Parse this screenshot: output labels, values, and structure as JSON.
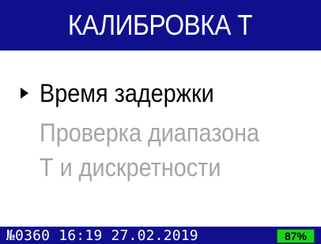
{
  "header": {
    "title": "КАЛИБРОВКА Т"
  },
  "menu": {
    "items": [
      {
        "lines": [
          "Время задержки"
        ],
        "selected": true
      },
      {
        "lines": [
          "Проверка диапазона",
          "Т и дискретности"
        ],
        "selected": false
      }
    ]
  },
  "status_bar": {
    "device_number": "№0360",
    "time": "16:19",
    "date": "27.02.2019",
    "battery": "87%"
  },
  "colors": {
    "bar_background": "#10108e",
    "selected_text": "#000000",
    "unselected_text": "#a5a5a5",
    "battery_fill": "#1dd41d"
  }
}
